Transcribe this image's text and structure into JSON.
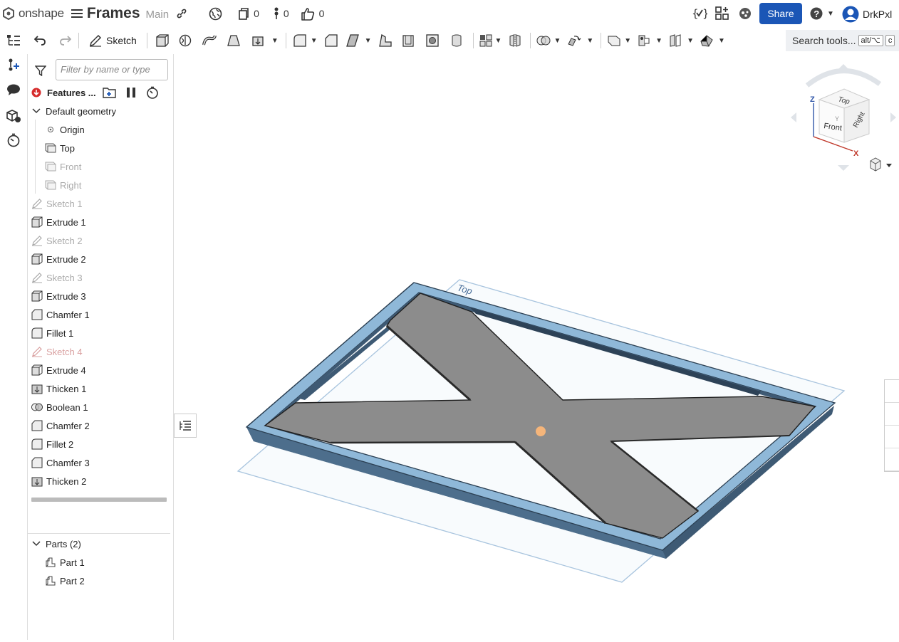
{
  "header": {
    "brand": "onshape",
    "doc_title": "Frames",
    "branch": "Main",
    "versions_count": "0",
    "branches_count": "0",
    "likes_count": "0",
    "share_label": "Share",
    "user_name": "DrkPxl"
  },
  "toolbar": {
    "sketch_label": "Sketch",
    "search_label": "Search tools...",
    "shortcut_1": "alt/⌥",
    "shortcut_2": "c"
  },
  "panel": {
    "filter_placeholder": "Filter by name or type",
    "features_title": "Features ...",
    "default_geometry": "Default geometry",
    "geometry_items": [
      "Origin",
      "Top",
      "Front",
      "Right"
    ],
    "features": [
      {
        "label": "Sketch 1",
        "icon": "sketch-icon"
      },
      {
        "label": "Extrude 1",
        "icon": "extrude-icon"
      },
      {
        "label": "Sketch 2",
        "icon": "sketch-icon"
      },
      {
        "label": "Extrude 2",
        "icon": "extrude-icon"
      },
      {
        "label": "Sketch 3",
        "icon": "sketch-icon"
      },
      {
        "label": "Extrude 3",
        "icon": "extrude-icon"
      },
      {
        "label": "Chamfer 1",
        "icon": "chamfer-icon"
      },
      {
        "label": "Fillet 1",
        "icon": "fillet-icon"
      },
      {
        "label": "Sketch 4",
        "icon": "sketch-icon"
      },
      {
        "label": "Extrude 4",
        "icon": "extrude-icon"
      },
      {
        "label": "Thicken 1",
        "icon": "thicken-icon"
      },
      {
        "label": "Boolean 1",
        "icon": "boolean-icon"
      },
      {
        "label": "Chamfer 2",
        "icon": "chamfer-icon"
      },
      {
        "label": "Fillet 2",
        "icon": "fillet-icon"
      },
      {
        "label": "Chamfer 3",
        "icon": "chamfer-icon"
      },
      {
        "label": "Thicken 2",
        "icon": "thicken-icon"
      }
    ],
    "parts_header": "Parts (2)",
    "parts": [
      "Part 1",
      "Part 2"
    ]
  },
  "viewport": {
    "plane_label": "Top",
    "cube_labels": {
      "top": "Top",
      "front": "Front",
      "right": "Right"
    },
    "axis_labels": {
      "z": "Z",
      "x": "X",
      "y": "Y"
    }
  },
  "colors": {
    "accent": "#1b56b6",
    "frame": "#8fb8d8",
    "plate": "#8c8c8c",
    "plane_line": "#a8c4de",
    "highlight": "#f5b57a"
  }
}
